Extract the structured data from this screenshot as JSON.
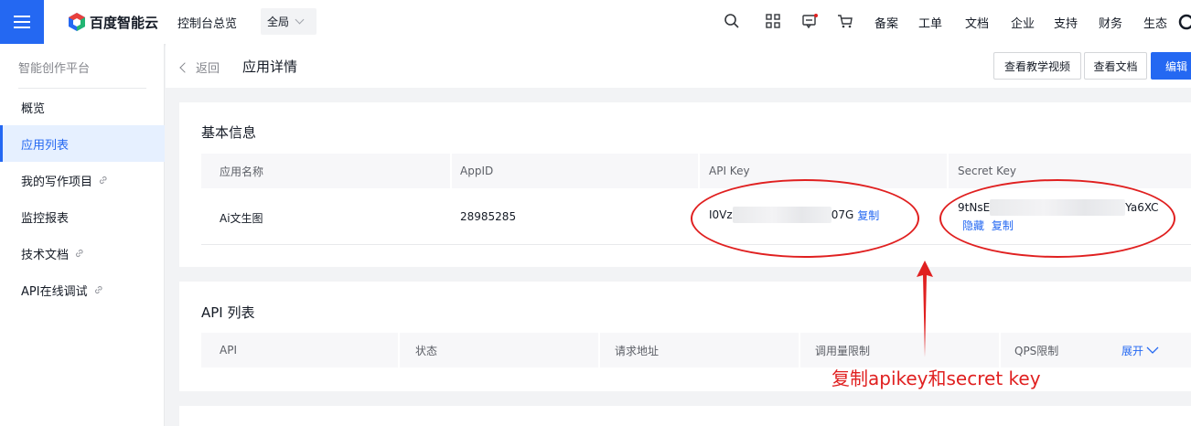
{
  "topbar": {
    "logo_text": "百度智能云",
    "overview": "控制台总览",
    "region": "全局",
    "links": [
      "备案",
      "工单",
      "文档",
      "企业",
      "支持",
      "财务",
      "生态"
    ],
    "icons": [
      "search-icon",
      "apps-icon",
      "message-icon",
      "cart-icon"
    ]
  },
  "sidebar": {
    "title": "智能创作平台",
    "items": [
      {
        "label": "概览"
      },
      {
        "label": "应用列表"
      },
      {
        "label": "我的写作项目"
      },
      {
        "label": "监控报表"
      },
      {
        "label": "技术文档"
      },
      {
        "label": "API在线调试"
      }
    ]
  },
  "header": {
    "back": "返回",
    "title": "应用详情",
    "btn_video": "查看教学视频",
    "btn_docs": "查看文档",
    "btn_edit": "编辑"
  },
  "basic_info": {
    "title": "基本信息",
    "columns": [
      "应用名称",
      "AppID",
      "API Key",
      "Secret Key"
    ],
    "app_name": "Ai文生图",
    "app_id": "28985285",
    "api_key_prefix": "I0Vz",
    "api_key_suffix": "07G",
    "copy": "复制",
    "secret_prefix": "9tNsE",
    "secret_suffix": "Ya6XC",
    "hide": "隐藏"
  },
  "api_list": {
    "title": "API 列表",
    "columns": [
      "API",
      "状态",
      "请求地址",
      "调用量限制",
      "QPS限制"
    ],
    "expand": "展开"
  },
  "annotation": {
    "text": "复制apikey和secret key",
    "color": "#e02020"
  }
}
